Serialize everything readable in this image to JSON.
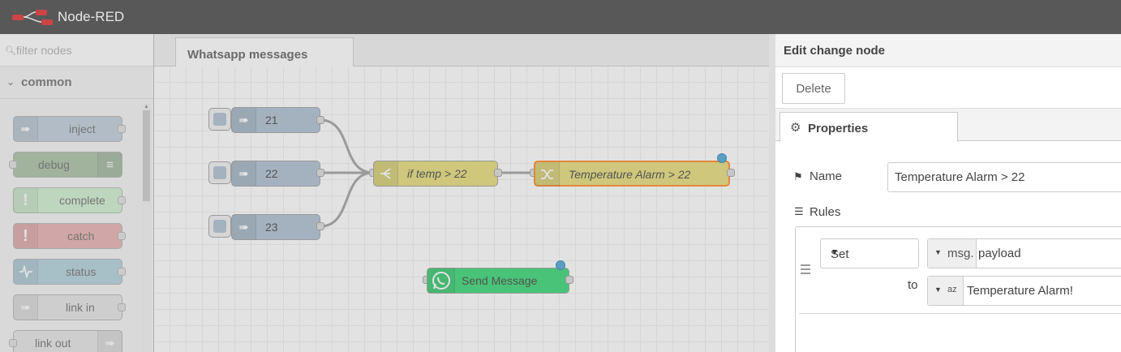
{
  "header": {
    "brand": "Node-RED"
  },
  "palette": {
    "filter_placeholder": "filter nodes",
    "category": "common",
    "nodes": [
      {
        "label": "inject",
        "color": "#a6bbcf",
        "icon": "arrow-in-icon"
      },
      {
        "label": "debug",
        "color": "#87a980",
        "icon": "list-icon"
      },
      {
        "label": "complete",
        "color": "#c0edc0",
        "icon": "exclamation-icon"
      },
      {
        "label": "catch",
        "color": "#e49191",
        "icon": "exclamation-icon"
      },
      {
        "label": "status",
        "color": "#94c1d0",
        "icon": "pulse-icon"
      },
      {
        "label": "link in",
        "color": "#dddddd",
        "icon": "link-in-icon"
      },
      {
        "label": "link out",
        "color": "#dddddd",
        "icon": "link-out-icon"
      }
    ]
  },
  "workspace": {
    "tab": "Whatsapp messages",
    "nodes": {
      "inject21": "21",
      "inject22": "22",
      "inject23": "23",
      "switch": "if temp > 22",
      "change": "Temperature Alarm > 22",
      "whatsapp": "Send Message"
    },
    "colors": {
      "inject": "#a6bbcf",
      "switch": "#e2d96e",
      "change": "#e2d96e",
      "whatsapp": "#25d366",
      "selected": "#ff7f0e"
    }
  },
  "editor": {
    "title": "Edit change node",
    "delete_label": "Delete",
    "tab_properties": "Properties",
    "name_label": "Name",
    "name_value": "Temperature Alarm > 22",
    "rules_label": "Rules",
    "rule": {
      "action": "Set",
      "target_prefix": "msg.",
      "target_value": "payload",
      "to_label": "to",
      "value_type_icon": "az",
      "value": "Temperature Alarm!"
    }
  }
}
